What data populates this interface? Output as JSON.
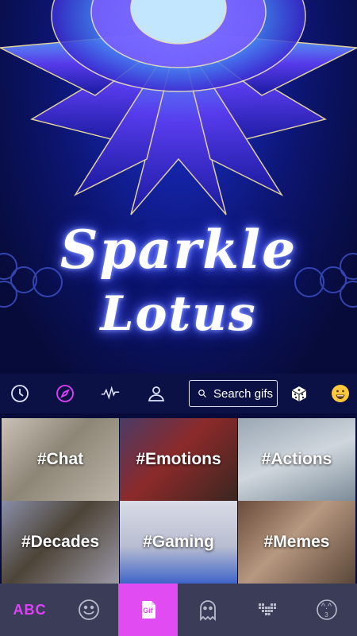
{
  "hero": {
    "title_line1": "Sparkle",
    "title_line2": "Lotus"
  },
  "toolbar": {
    "icons": [
      "clock-icon",
      "compass-icon",
      "waveform-icon",
      "person-icon",
      "dice-icon",
      "smiley-icon"
    ],
    "search_placeholder": "Search gifs",
    "active_color": "#e040fb"
  },
  "categories": [
    {
      "label": "#Chat"
    },
    {
      "label": "#Emotions"
    },
    {
      "label": "#Actions"
    },
    {
      "label": "#Decades"
    },
    {
      "label": "#Gaming"
    },
    {
      "label": "#Memes"
    }
  ],
  "bottom_bar": {
    "abc_label": "ABC",
    "gif_label": "Gif",
    "emoticon_label": "^.^",
    "emoticon_count": "3",
    "active_tab": "gif",
    "accent": "#e14cf2",
    "background": "#3a3c58"
  }
}
